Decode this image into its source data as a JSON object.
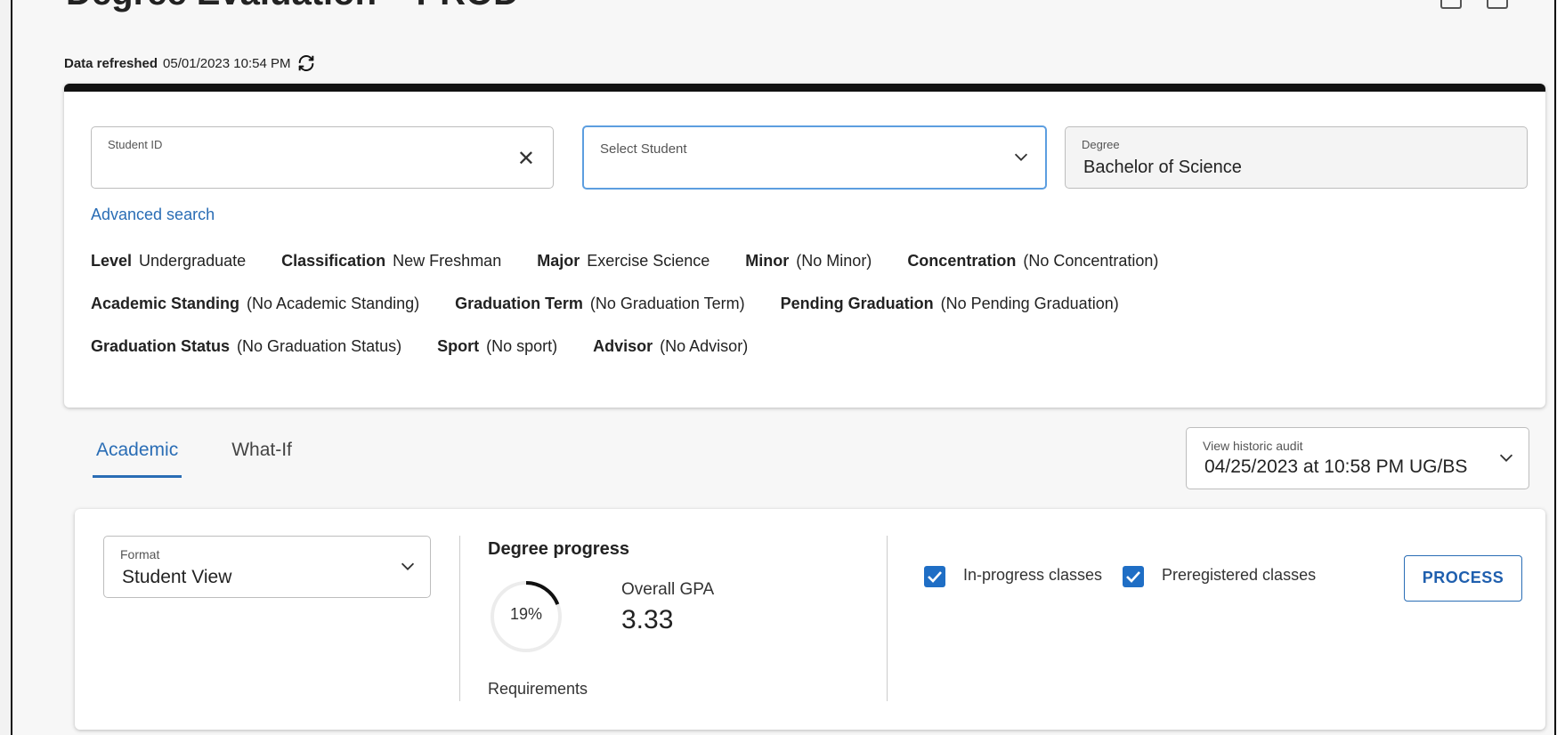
{
  "header": {
    "title": "Degree Evaluation – PROD",
    "refreshed_label": "Data refreshed",
    "refreshed_time": "05/01/2023 10:54 PM"
  },
  "search": {
    "student_id_label": "Student ID",
    "student_id_value": "",
    "select_student_label": "Select Student",
    "degree_label": "Degree",
    "degree_value": "Bachelor of Science",
    "advanced_search": "Advanced search"
  },
  "student_info": {
    "level": {
      "key": "Level",
      "value": "Undergraduate"
    },
    "classification": {
      "key": "Classification",
      "value": "New Freshman"
    },
    "major": {
      "key": "Major",
      "value": "Exercise Science"
    },
    "minor": {
      "key": "Minor",
      "value": "(No Minor)"
    },
    "concentration": {
      "key": "Concentration",
      "value": "(No Concentration)"
    },
    "academic_standing": {
      "key": "Academic Standing",
      "value": "(No Academic Standing)"
    },
    "graduation_term": {
      "key": "Graduation Term",
      "value": "(No Graduation Term)"
    },
    "pending_graduation": {
      "key": "Pending Graduation",
      "value": "(No Pending Graduation)"
    },
    "graduation_status": {
      "key": "Graduation Status",
      "value": "(No Graduation Status)"
    },
    "sport": {
      "key": "Sport",
      "value": "(No sport)"
    },
    "advisor": {
      "key": "Advisor",
      "value": "(No Advisor)"
    }
  },
  "tabs": [
    {
      "label": "Academic",
      "active": true
    },
    {
      "label": "What-If",
      "active": false
    }
  ],
  "historic": {
    "label": "View historic audit",
    "value": "04/25/2023 at 10:58 PM UG/BS"
  },
  "audit": {
    "format_label": "Format",
    "format_value": "Student View",
    "degree_progress_title": "Degree progress",
    "progress_percent": "19%",
    "progress_fraction": 0.19,
    "gpa_label": "Overall GPA",
    "gpa_value": "3.33",
    "requirements_label": "Requirements",
    "in_progress_label": "In-progress classes",
    "in_progress_checked": true,
    "preregistered_label": "Preregistered classes",
    "preregistered_checked": true,
    "process_button": "PROCESS"
  },
  "colors": {
    "accent": "#2a6db5",
    "checkbox": "#1f6ec5",
    "focus_border": "#5c9ee0"
  }
}
